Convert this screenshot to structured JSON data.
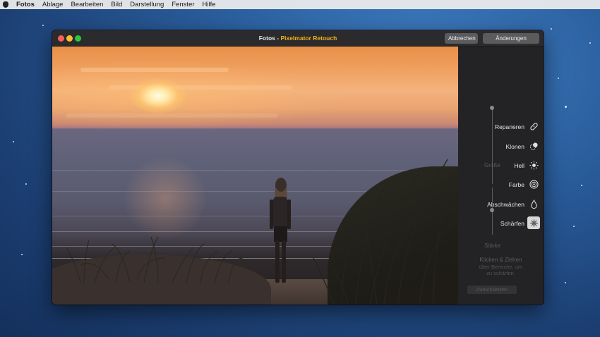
{
  "menubar": {
    "app": "Fotos",
    "items": [
      "Ablage",
      "Bearbeiten",
      "Bild",
      "Darstellung",
      "Fenster",
      "Hilfe"
    ]
  },
  "window": {
    "title_app": "Fotos",
    "title_separator": " - ",
    "title_extension": "Pixelmator Retouch",
    "cancel_label": "Abbrechen",
    "save_label": "Änderungen sichern"
  },
  "panel": {
    "size_label": "Größe",
    "tools": [
      {
        "label": "Reparieren",
        "icon": "bandage-icon",
        "active": false
      },
      {
        "label": "Klonen",
        "icon": "clone-stamp-icon",
        "active": false
      },
      {
        "label": "Hell",
        "icon": "sun-icon",
        "active": false
      },
      {
        "label": "Farbe",
        "icon": "color-target-icon",
        "active": false
      },
      {
        "label": "Abschwächen",
        "icon": "drop-icon",
        "active": false
      },
      {
        "label": "Schärfen",
        "icon": "sharpen-icon",
        "active": true
      }
    ],
    "strength_label": "Stärke",
    "hint_title": "Klicken & Ziehen",
    "hint_line1": "über Bereiche, um",
    "hint_line2": "zu schärfen.",
    "reset_label": "Zurücksetzen"
  },
  "colors": {
    "accent_extension": "#f4b01b",
    "active_tool_bg": "#d8d8d8"
  }
}
